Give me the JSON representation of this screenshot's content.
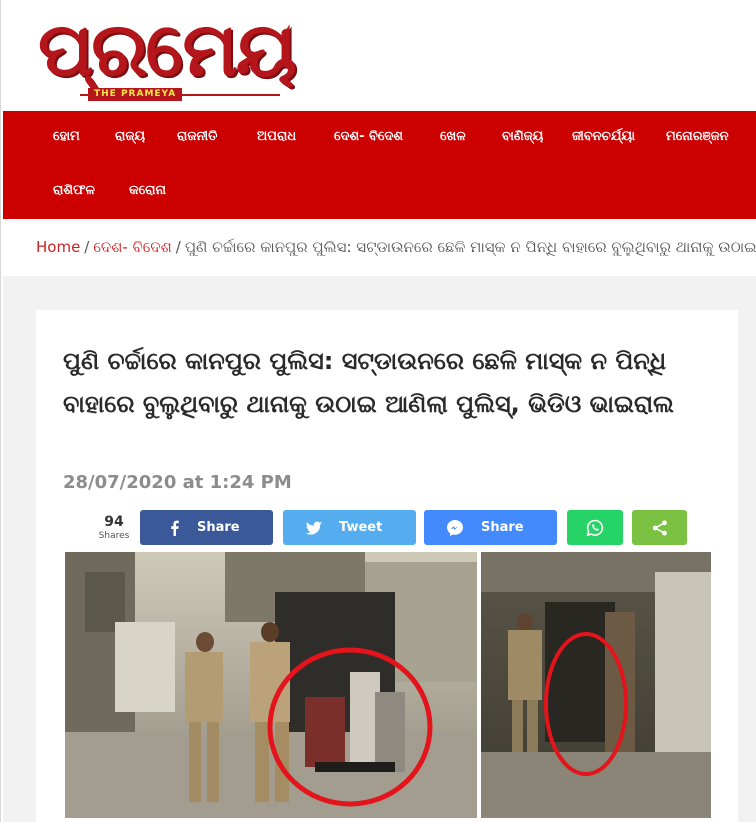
{
  "logo": {
    "main": "ପ୍ରମେୟ",
    "tag": "THE PRAMEYA"
  },
  "nav": {
    "items": [
      "ହୋମ",
      "ରାଜ୍ୟ",
      "ରାଜନୀତି",
      "ଅପରାଧ",
      "ଦେଶ- ବିଦେଶ",
      "ଖେଳ",
      "ବାଣିଜ୍ୟ",
      "ଜୀବନଚର୍ଯ୍ୟା",
      "ମନୋରଞ୍ଜନ",
      "ରାଶିଫଳ",
      "କରୋନା"
    ]
  },
  "breadcrumb": {
    "home": "Home",
    "category": "ଦେଶ- ବିଦେଶ",
    "current": "ପୁଣି ଚର୍ଚ୍ଚାରେ କାନପୁର ପୁଲିସ: ସଟ୍‌ଡାଉନରେ ଛେଳି ମାସ୍କ ନ ପିନ୍ଧି ବାହାରେ ବୁଲୁଥିବାରୁ ଥାନାକୁ ଉଠାଇ ଆଣିଲା ପୁଲିସ୍, ଭିଡିଓ ଭାଇରାଲ",
    "separator": "/"
  },
  "article": {
    "title": "ପୁଣି ଚର୍ଚ୍ଚାରେ କାନପୁର ପୁଲିସ: ସଟ୍‌ଡାଉନରେ ଛେଳି ମାସ୍କ ନ ପିନ୍ଧି ବାହାରେ ବୁଲୁଥିବାରୁ ଥାନାକୁ ଉଠାଇ ଆଣିଲା ପୁଲିସ୍, ଭିଡିଓ ଭାଇରାଲ",
    "date": "28/07/2020 at 1:24 PM"
  },
  "share": {
    "count": "94",
    "count_label": "Shares",
    "facebook_label": "Share",
    "twitter_label": "Tweet",
    "messenger_label": "Share"
  },
  "colors": {
    "nav_bg": "#cc0000",
    "facebook": "#3b5998",
    "twitter": "#55acee",
    "messenger": "#448aff",
    "whatsapp": "#25d366",
    "share": "#7bc142"
  }
}
